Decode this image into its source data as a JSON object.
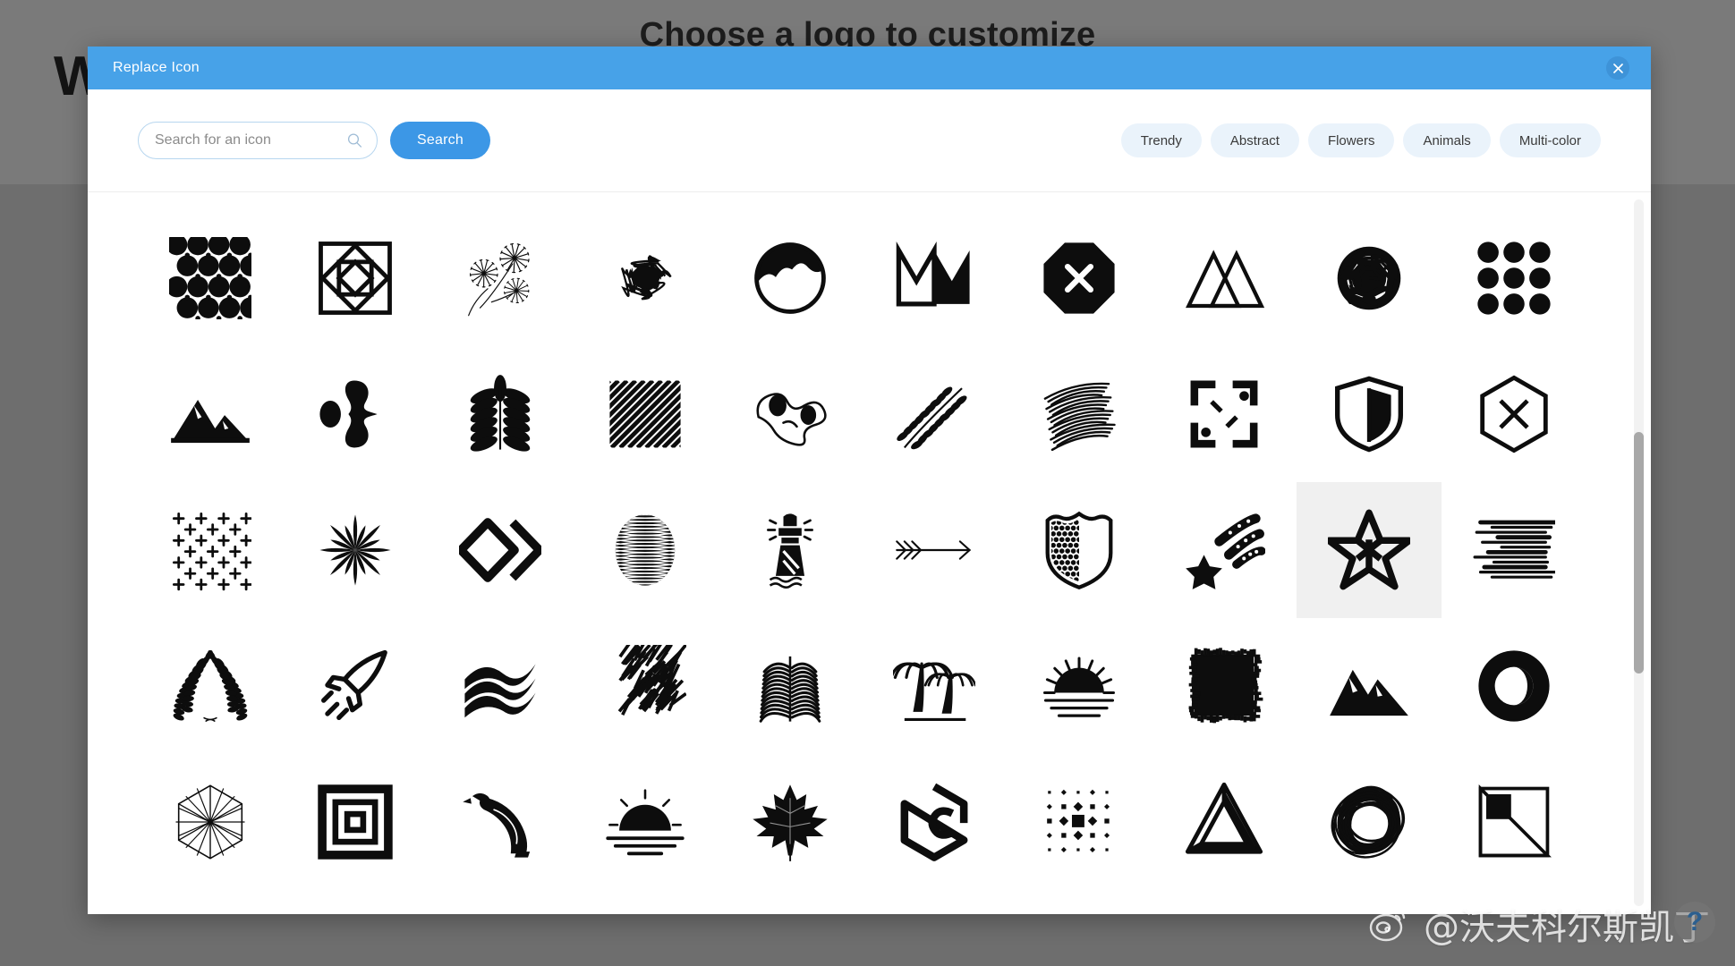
{
  "background": {
    "heading": "Choose a logo to customize",
    "wordmark": "W"
  },
  "modal": {
    "title": "Replace Icon",
    "close_icon": "close-icon",
    "accent_color": "#47a2e8",
    "header_color": "#47a2e8"
  },
  "toolbar": {
    "search_placeholder": "Search for an icon",
    "search_value": "",
    "search_icon": "search-icon",
    "search_button_label": "Search",
    "search_button_color": "#3c97e6",
    "pills": [
      {
        "label": "Trendy"
      },
      {
        "label": "Abstract"
      },
      {
        "label": "Flowers"
      },
      {
        "label": "Animals"
      },
      {
        "label": "Multi-color"
      }
    ],
    "pill_color": "#eaf3fb"
  },
  "grid": {
    "columns": 10,
    "selected_index": 28,
    "selected_highlight_color": "#f0f0f0",
    "icons": [
      {
        "name": "circle-pattern-icon"
      },
      {
        "name": "nested-squares-icon"
      },
      {
        "name": "line-art-flowers-icon"
      },
      {
        "name": "scribble-ball-icon"
      },
      {
        "name": "globe-landscape-icon"
      },
      {
        "name": "crown-icon"
      },
      {
        "name": "octagon-x-icon"
      },
      {
        "name": "double-triangle-mountains-icon"
      },
      {
        "name": "ink-blot-circle-icon"
      },
      {
        "name": "nine-dots-grid-icon"
      },
      {
        "name": "mountain-range-icon"
      },
      {
        "name": "molecule-blob-icon"
      },
      {
        "name": "fern-leaf-icon"
      },
      {
        "name": "diagonal-stripes-square-icon"
      },
      {
        "name": "abstract-squiggle-blob-icon"
      },
      {
        "name": "olive-branch-icon"
      },
      {
        "name": "scribble-lines-icon"
      },
      {
        "name": "bracket-corners-dots-icon"
      },
      {
        "name": "shield-split-icon"
      },
      {
        "name": "hexagon-x-icon"
      },
      {
        "name": "plus-dot-grid-icon"
      },
      {
        "name": "starburst-petals-icon"
      },
      {
        "name": "diamond-chevron-icon"
      },
      {
        "name": "striped-sphere-icon"
      },
      {
        "name": "lighthouse-icon"
      },
      {
        "name": "triple-arrow-icon"
      },
      {
        "name": "dotted-shield-icon"
      },
      {
        "name": "shooting-star-icon"
      },
      {
        "name": "outlined-star-icon"
      },
      {
        "name": "speed-lines-icon"
      },
      {
        "name": "laurel-wreath-icon"
      },
      {
        "name": "rocket-icon"
      },
      {
        "name": "wave-stripes-icon"
      },
      {
        "name": "scribbled-square-icon"
      },
      {
        "name": "palm-frond-icon"
      },
      {
        "name": "palm-trees-icon"
      },
      {
        "name": "sunrise-rays-icon"
      },
      {
        "name": "rough-filled-square-icon"
      },
      {
        "name": "mountain-peaks-icon"
      },
      {
        "name": "eclipse-circle-icon"
      },
      {
        "name": "hexagon-burst-icon"
      },
      {
        "name": "concentric-squares-icon"
      },
      {
        "name": "eagle-icon"
      },
      {
        "name": "sunset-water-icon"
      },
      {
        "name": "maple-leaf-icon"
      },
      {
        "name": "hexagon-c-monogram-icon"
      },
      {
        "name": "dot-matrix-diamond-icon"
      },
      {
        "name": "penrose-triangle-icon"
      },
      {
        "name": "scribble-circle-icon"
      },
      {
        "name": "split-square-icon"
      }
    ]
  },
  "scrollbar": {
    "thumb_position_percent": 50,
    "track_color": "#f2f2f2",
    "thumb_color": "#a8a8a8"
  },
  "watermark": {
    "handle": "@沃夫科尔斯凯丁",
    "logo": "weibo-icon"
  },
  "help": {
    "label": "?"
  }
}
